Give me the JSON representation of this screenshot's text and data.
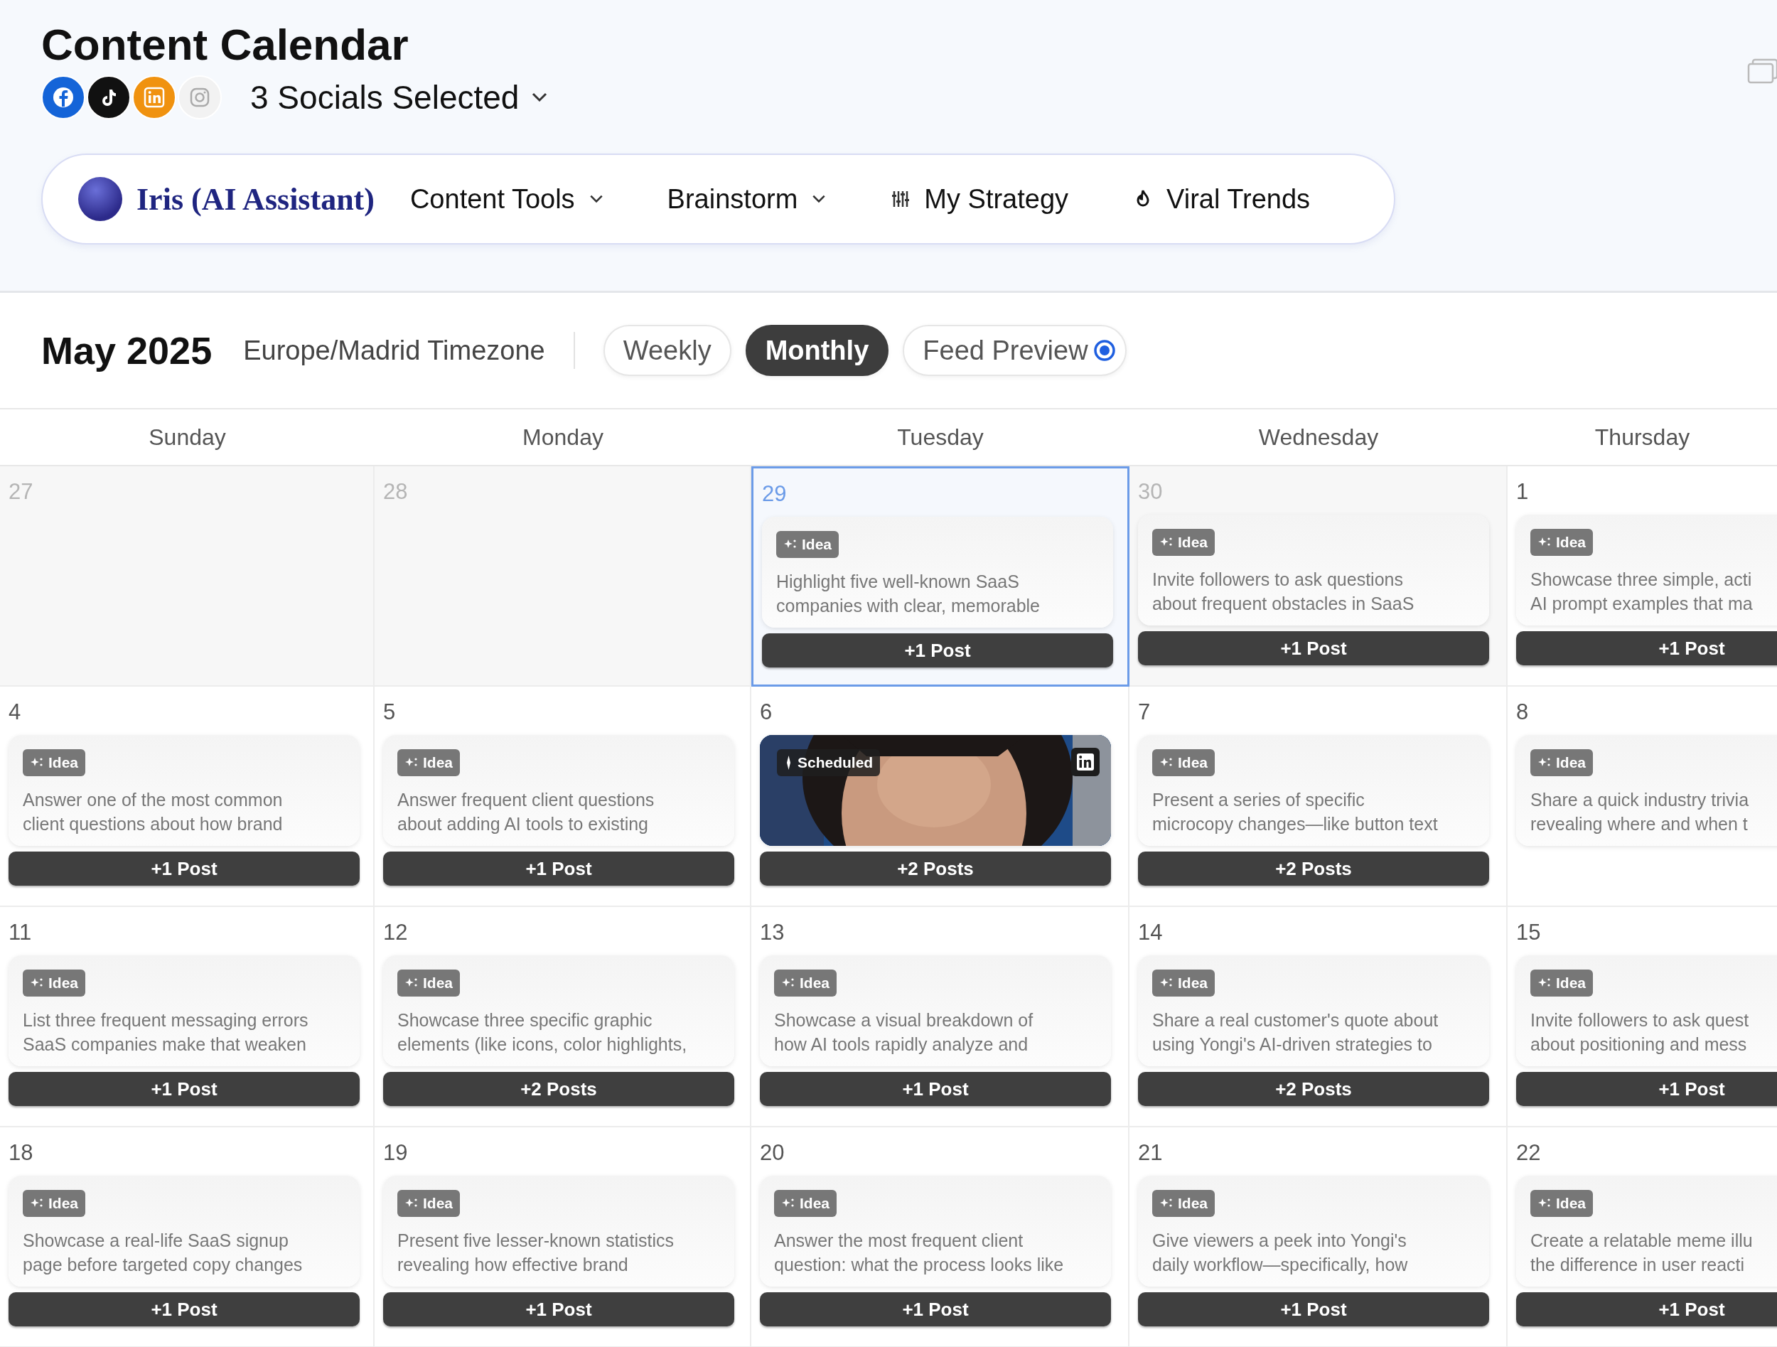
{
  "page": {
    "title": "Content Calendar"
  },
  "socials": {
    "items": [
      {
        "kind": "facebook",
        "selected": true
      },
      {
        "kind": "tiktok",
        "selected": true
      },
      {
        "kind": "linkedin",
        "selected": true
      },
      {
        "kind": "instagram",
        "selected": false
      }
    ],
    "label": "3 Socials Selected"
  },
  "nav": {
    "assistant": "Iris (AI Assistant)",
    "items": [
      {
        "label": "Content Tools",
        "kind": "dropdown"
      },
      {
        "label": "Brainstorm",
        "kind": "dropdown"
      },
      {
        "label": "My Strategy",
        "kind": "strategy"
      },
      {
        "label": "Viral Trends",
        "kind": "trends"
      }
    ]
  },
  "toolbar": {
    "month": "May 2025",
    "timezone": "Europe/Madrid Timezone",
    "views": [
      {
        "label": "Weekly",
        "selected": false
      },
      {
        "label": "Monthly",
        "selected": true
      },
      {
        "label": "Feed Preview",
        "selected": false
      }
    ]
  },
  "calendar": {
    "days_of_week": [
      "Sunday",
      "Monday",
      "Tuesday",
      "Wednesday",
      "Thursday"
    ],
    "weeks": [
      {
        "days": [
          {
            "date": "27",
            "muted": true,
            "selected": false
          },
          {
            "date": "28",
            "muted": true,
            "selected": false
          },
          {
            "date": "29",
            "muted": true,
            "selected": true,
            "card": {
              "kind": "idea",
              "badge": "Idea",
              "lines": [
                "Highlight five well-known SaaS",
                "companies with clear, memorable"
              ]
            },
            "posts": "+1 Post"
          },
          {
            "date": "30",
            "muted": true,
            "selected": false,
            "card": {
              "kind": "idea",
              "badge": "Idea",
              "lines": [
                "Invite followers to ask questions",
                "about frequent obstacles in SaaS"
              ]
            },
            "posts": "+1 Post"
          },
          {
            "date": "1",
            "muted": false,
            "selected": false,
            "card": {
              "kind": "idea",
              "badge": "Idea",
              "lines": [
                "Showcase three simple, acti",
                "AI prompt examples that ma"
              ]
            },
            "posts": "+1 Post"
          }
        ]
      },
      {
        "days": [
          {
            "date": "4",
            "muted": false,
            "selected": false,
            "card": {
              "kind": "idea",
              "badge": "Idea",
              "lines": [
                "Answer one of the most common",
                "client questions about how brand"
              ]
            },
            "posts": "+1 Post"
          },
          {
            "date": "5",
            "muted": false,
            "selected": false,
            "card": {
              "kind": "idea",
              "badge": "Idea",
              "lines": [
                "Answer frequent client questions",
                "about adding AI tools to existing"
              ]
            },
            "posts": "+1 Post"
          },
          {
            "date": "6",
            "muted": false,
            "selected": false,
            "card": {
              "kind": "scheduled",
              "badge": "Scheduled"
            },
            "posts": "+2 Posts"
          },
          {
            "date": "7",
            "muted": false,
            "selected": false,
            "card": {
              "kind": "idea",
              "badge": "Idea",
              "lines": [
                "Present a series of specific",
                "microcopy changes—like button text"
              ]
            },
            "posts": "+2 Posts"
          },
          {
            "date": "8",
            "muted": false,
            "selected": false,
            "card": {
              "kind": "idea",
              "badge": "Idea",
              "lines": [
                "Share a quick industry trivia",
                "revealing where and when t"
              ]
            }
          }
        ]
      },
      {
        "days": [
          {
            "date": "11",
            "muted": false,
            "selected": false,
            "card": {
              "kind": "idea",
              "badge": "Idea",
              "lines": [
                "List three frequent messaging errors",
                "SaaS companies make that weaken"
              ]
            },
            "posts": "+1 Post"
          },
          {
            "date": "12",
            "muted": false,
            "selected": false,
            "card": {
              "kind": "idea",
              "badge": "Idea",
              "lines": [
                "Showcase three specific graphic",
                "elements (like icons, color highlights,"
              ]
            },
            "posts": "+2 Posts"
          },
          {
            "date": "13",
            "muted": false,
            "selected": false,
            "card": {
              "kind": "idea",
              "badge": "Idea",
              "lines": [
                "Showcase a visual breakdown of",
                "how AI tools rapidly analyze and"
              ]
            },
            "posts": "+1 Post"
          },
          {
            "date": "14",
            "muted": false,
            "selected": false,
            "card": {
              "kind": "idea",
              "badge": "Idea",
              "lines": [
                "Share a real customer's quote about",
                "using Yongi's AI-driven strategies to"
              ]
            },
            "posts": "+2 Posts"
          },
          {
            "date": "15",
            "muted": false,
            "selected": false,
            "card": {
              "kind": "idea",
              "badge": "Idea",
              "lines": [
                "Invite followers to ask quest",
                "about positioning and mess"
              ]
            },
            "posts": "+1 Post"
          }
        ]
      },
      {
        "days": [
          {
            "date": "18",
            "muted": false,
            "selected": false,
            "card": {
              "kind": "idea",
              "badge": "Idea",
              "lines": [
                "Showcase a real-life SaaS signup",
                "page before targeted copy changes"
              ]
            },
            "posts": "+1 Post"
          },
          {
            "date": "19",
            "muted": false,
            "selected": false,
            "card": {
              "kind": "idea",
              "badge": "Idea",
              "lines": [
                "Present five lesser-known statistics",
                "revealing how effective brand"
              ]
            },
            "posts": "+1 Post"
          },
          {
            "date": "20",
            "muted": false,
            "selected": false,
            "card": {
              "kind": "idea",
              "badge": "Idea",
              "lines": [
                "Answer the most frequent client",
                "question: what the process looks like"
              ]
            },
            "posts": "+1 Post"
          },
          {
            "date": "21",
            "muted": false,
            "selected": false,
            "card": {
              "kind": "idea",
              "badge": "Idea",
              "lines": [
                "Give viewers a peek into Yongi's",
                "daily workflow—specifically, how"
              ]
            },
            "posts": "+1 Post"
          },
          {
            "date": "22",
            "muted": false,
            "selected": false,
            "card": {
              "kind": "idea",
              "badge": "Idea",
              "lines": [
                "Create a relatable meme illu",
                "the difference in user reacti"
              ]
            },
            "posts": "+1 Post"
          }
        ]
      }
    ]
  }
}
